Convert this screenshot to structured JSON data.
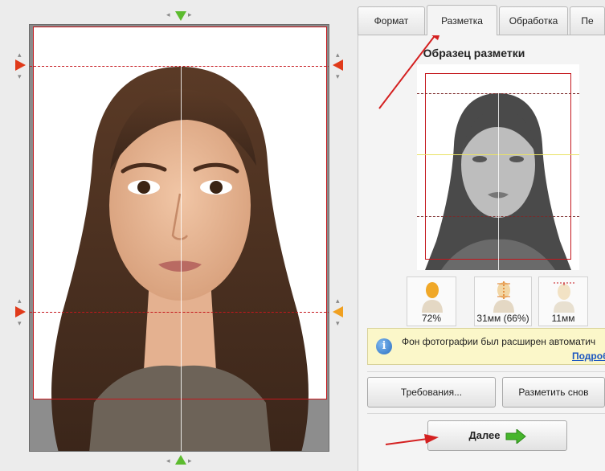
{
  "tabs": [
    {
      "label": "Формат",
      "active": false
    },
    {
      "label": "Разметка",
      "active": true
    },
    {
      "label": "Обработка",
      "active": false
    },
    {
      "label": "Пе",
      "active": false
    }
  ],
  "sample": {
    "title": "Образец разметки"
  },
  "metrics": [
    {
      "icon": "head-ratio-icon",
      "value": "72%"
    },
    {
      "icon": "face-height-icon",
      "value": "31мм (66%)"
    },
    {
      "icon": "top-margin-icon",
      "value": "11мм"
    }
  ],
  "info": {
    "text": "Фон фотографии был расширен автоматич",
    "link": "Подроб"
  },
  "buttons": {
    "requirements": "Требования...",
    "mark_again": "Разметить снов",
    "next": "Далее"
  },
  "colors": {
    "guide_red": "#c4161c",
    "annotation_red": "#d42020",
    "handle_green": "#5cbb2e",
    "link_blue": "#1a55c0",
    "info_bg": "#fbf7c9"
  }
}
